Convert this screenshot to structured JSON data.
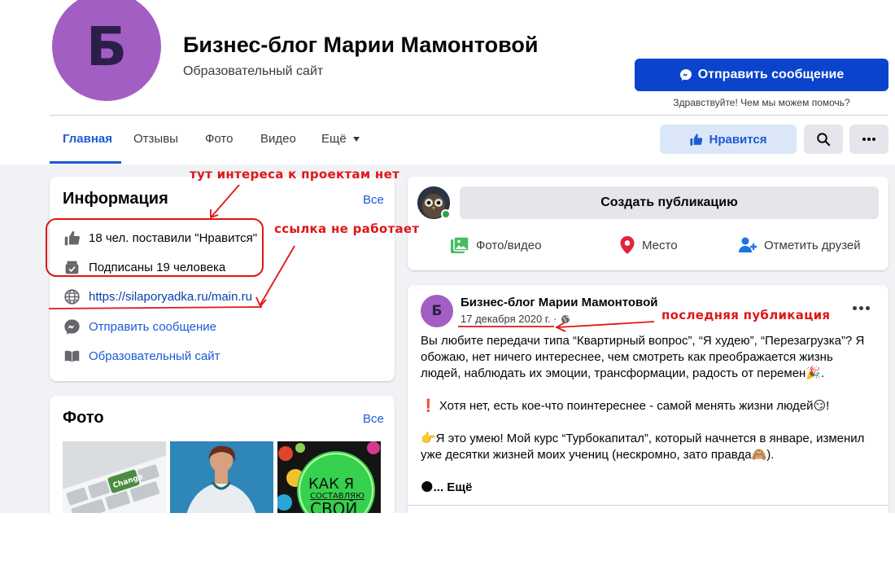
{
  "header": {
    "avatar_letter": "Б",
    "page_name": "Бизнес-блог Марии Мамонтовой",
    "category": "Образовательный сайт",
    "send_message_label": "Отправить сообщение",
    "greeting": "Здравствуйте! Чем мы можем помочь?",
    "like_label": "Нравится"
  },
  "nav": {
    "tabs": [
      {
        "label": "Главная",
        "active": true
      },
      {
        "label": "Отзывы"
      },
      {
        "label": "Фото"
      },
      {
        "label": "Видео"
      },
      {
        "label": "Ещё"
      }
    ]
  },
  "info_card": {
    "title": "Информация",
    "see_all": "Все",
    "likes": "18 чел. поставили \"Нравится\"",
    "followers": "Подписаны 19 человека",
    "website": "https://silaporyadka.ru/main.ru",
    "message": "Отправить сообщение",
    "category": "Образовательный сайт"
  },
  "photos_card": {
    "title": "Фото",
    "see_all": "Все",
    "tile1_key_label": "Change",
    "tile3_text": [
      "КАК Я",
      "СОСТАВЛЯЮ",
      "СВОЙ"
    ]
  },
  "create_post": {
    "placeholder": "Создать публикацию",
    "actions": [
      "Фото/видео",
      "Место",
      "Отметить друзей"
    ]
  },
  "post": {
    "avatar_letter": "Б",
    "author": "Бизнес-блог Марии Мамонтовой",
    "date": "17 декабря 2020 г. ·",
    "paragraphs": [
      "Вы любите передачи типа “Квартирный вопрос”, “Я худею”, “Перезагрузка”? Я обожаю, нет ничего интереснее, чем смотреть как преображается жизнь людей, наблюдать их эмоции, трансформации, радость от перемен🎉.",
      "❗ Хотя нет, есть кое-что поинтереснее - самой менять жизни людей😏!",
      "👉Я это умею! Мой курс “Турбокапитал”, который начнется в январе, изменил уже десятки жизней моих учениц (нескромно, зато правда🙈)."
    ],
    "more_prefix": "🌑",
    "more_label": "... Ещё"
  },
  "annotations": {
    "no_interest": "тут интереса к проектам нет",
    "link_broken": "ссылка не работает",
    "last_post": "последняя публикация"
  },
  "colors": {
    "brand_blue": "#1b5ad7",
    "send_button": "#0a43cc",
    "avatar_purple": "#a35ec4",
    "annotation_red": "#e11616",
    "page_bg": "#f0f2f5"
  }
}
